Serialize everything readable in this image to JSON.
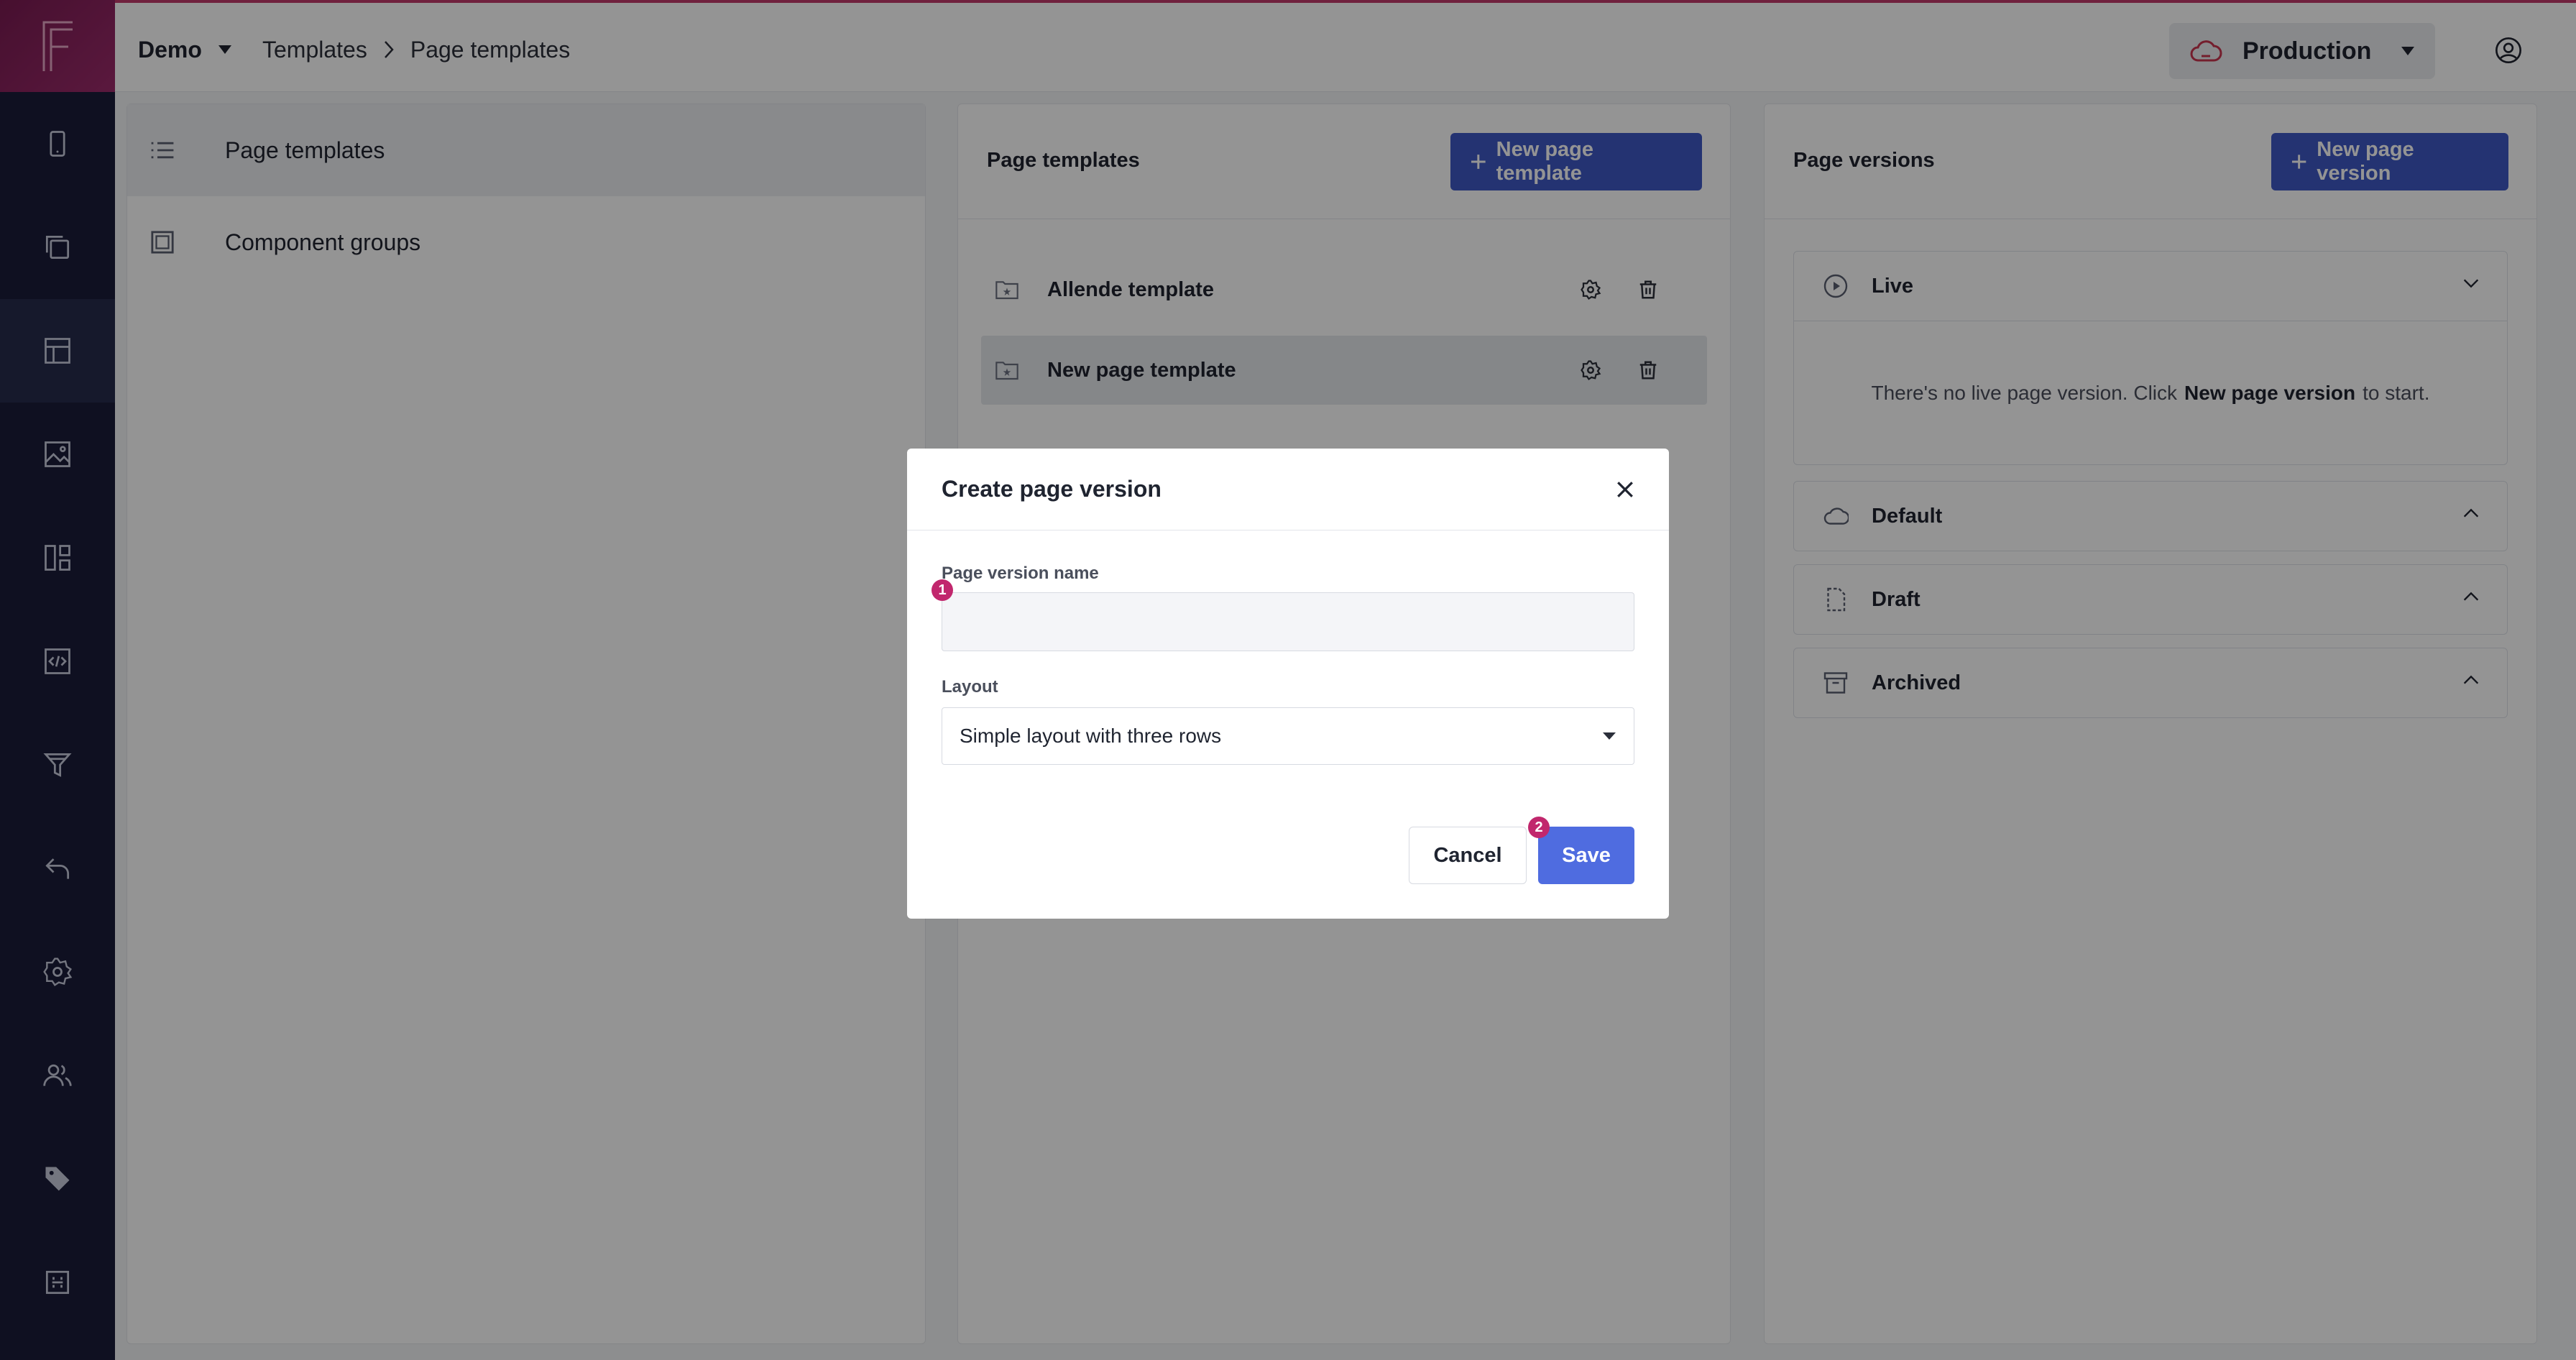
{
  "app": {
    "logo_letter": "F",
    "workspace": "Demo",
    "breadcrumb": [
      "Templates",
      "Page templates"
    ],
    "environment": "Production",
    "colors": {
      "brand": "#9c2b6b",
      "primary": "#3f58c4",
      "badge": "#c1276d"
    }
  },
  "rail": {
    "items": [
      {
        "icon": "mobile-icon"
      },
      {
        "icon": "pages-stack-icon"
      },
      {
        "icon": "template-layout-icon",
        "active": true
      },
      {
        "icon": "media-image-icon"
      },
      {
        "icon": "components-grid-icon"
      },
      {
        "icon": "code-icon"
      },
      {
        "icon": "filter-funnel-icon"
      },
      {
        "icon": "redirect-back-icon"
      },
      {
        "icon": "settings-gear-icon"
      },
      {
        "icon": "users-icon"
      },
      {
        "icon": "tag-icon"
      },
      {
        "icon": "extensions-icon"
      }
    ]
  },
  "nav": {
    "items": [
      {
        "label": "Page templates",
        "icon": "list-icon",
        "active": true
      },
      {
        "label": "Component groups",
        "icon": "square-icon"
      }
    ]
  },
  "templates_panel": {
    "title": "Page templates",
    "new_button": "New page template",
    "rows": [
      {
        "name": "Allende template"
      },
      {
        "name": "New page template",
        "active": true
      }
    ]
  },
  "versions_panel": {
    "title": "Page versions",
    "new_button": "New page version",
    "sections": [
      {
        "label": "Live",
        "icon": "play-circle-icon",
        "expanded": true
      },
      {
        "label": "Default",
        "icon": "cloud-icon"
      },
      {
        "label": "Draft",
        "icon": "draft-page-icon"
      },
      {
        "label": "Archived",
        "icon": "archive-box-icon"
      }
    ],
    "live_empty": {
      "before": "There's no live page version. Click",
      "link": "New page version",
      "after": "to start."
    }
  },
  "modal": {
    "title": "Create page version",
    "name_label": "Page version name",
    "name_value": "",
    "layout_label": "Layout",
    "layout_value": "Simple layout with three rows",
    "cancel": "Cancel",
    "save": "Save",
    "badges": [
      "1",
      "2"
    ]
  }
}
